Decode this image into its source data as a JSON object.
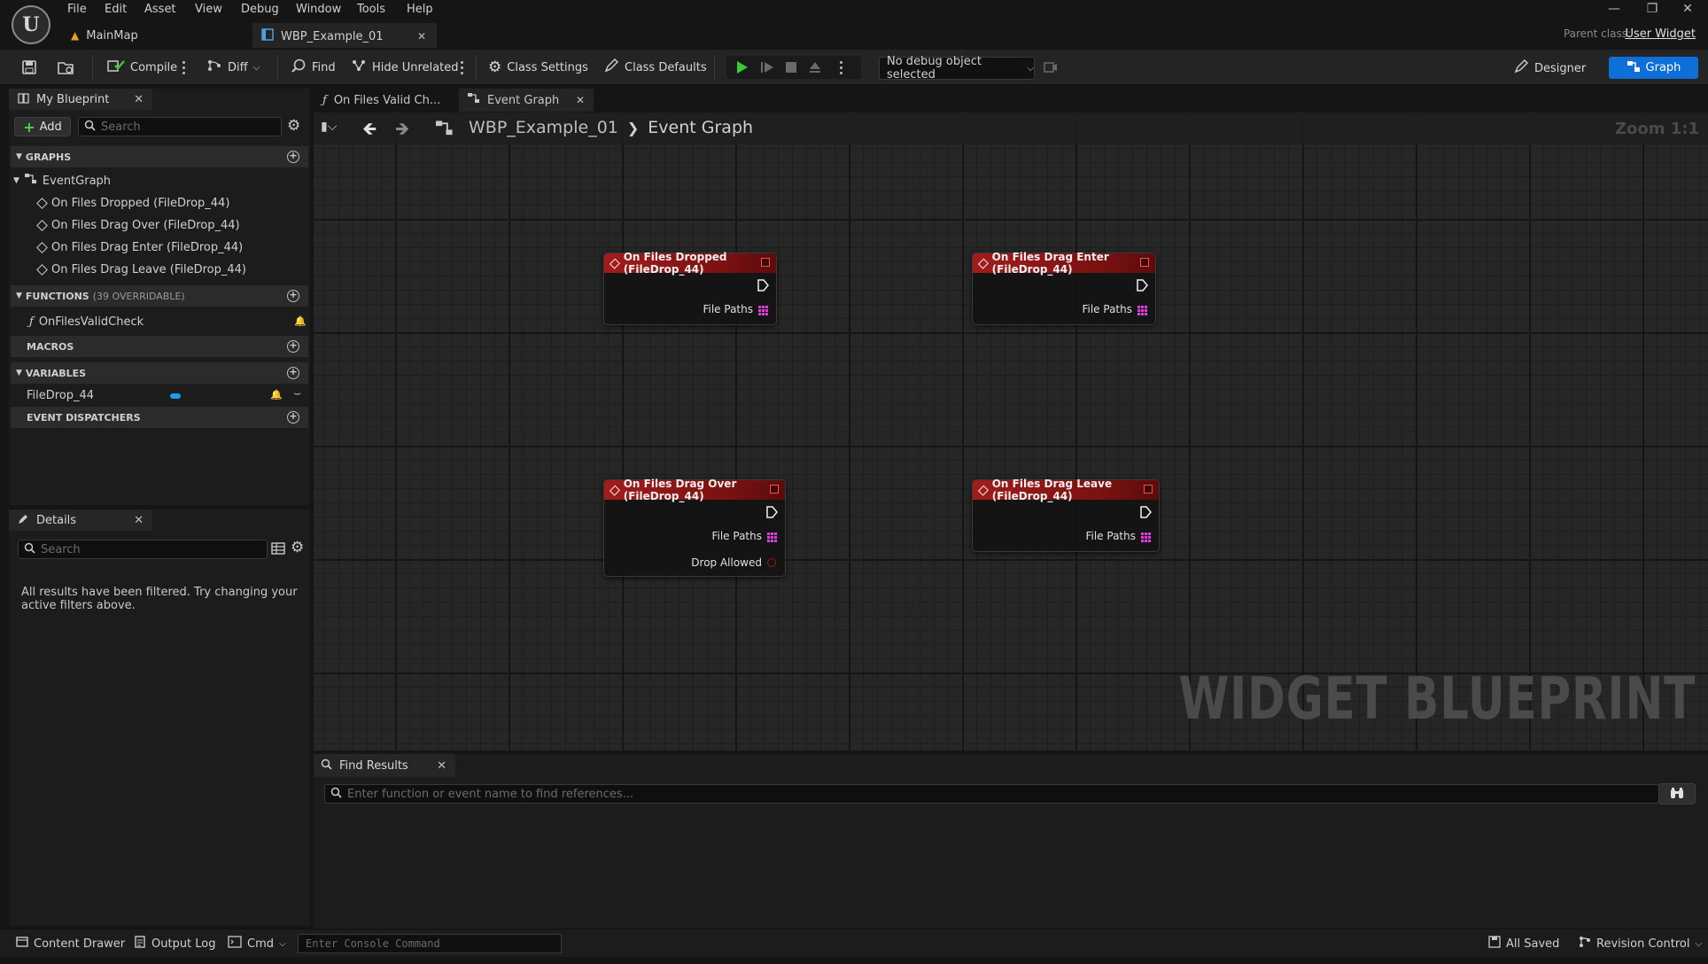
{
  "menu": [
    "File",
    "Edit",
    "Asset",
    "View",
    "Debug",
    "Window",
    "Tools",
    "Help"
  ],
  "logo_letter": "U",
  "doc_tabs": [
    {
      "label": "MainMap"
    },
    {
      "label": "WBP_Example_01"
    }
  ],
  "parent_class": {
    "label": "Parent class:",
    "value": "User Widget"
  },
  "toolbar": {
    "compile": "Compile",
    "diff": "Diff",
    "find": "Find",
    "hide_unrelated": "Hide Unrelated",
    "class_settings": "Class Settings",
    "class_defaults": "Class Defaults",
    "debug_object": "No debug object selected",
    "designer": "Designer",
    "graph": "Graph"
  },
  "my_blueprint": {
    "tab_label": "My Blueprint",
    "add_label": "Add",
    "search_placeholder": "Search",
    "sections": {
      "graphs": "GRAPHS",
      "functions": "FUNCTIONS",
      "functions_sub": "(39 OVERRIDABLE)",
      "macros": "MACROS",
      "variables": "VARIABLES",
      "event_dispatchers": "EVENT DISPATCHERS"
    },
    "event_graph": "EventGraph",
    "events": [
      "On Files Dropped (FileDrop_44)",
      "On Files Drag Over (FileDrop_44)",
      "On Files Drag Enter (FileDrop_44)",
      "On Files Drag Leave (FileDrop_44)"
    ],
    "functions": [
      "OnFilesValidCheck"
    ],
    "variables": [
      "FileDrop_44"
    ]
  },
  "details": {
    "tab_label": "Details",
    "search_placeholder": "Search",
    "empty_message": "All results have been filtered. Try changing your active filters above."
  },
  "graph_tabs": [
    {
      "label": "On Files Valid Ch..."
    },
    {
      "label": "Event Graph"
    }
  ],
  "breadcrumb": {
    "root": "WBP_Example_01",
    "current": "Event Graph"
  },
  "zoom": "Zoom 1:1",
  "watermark": "WIDGET BLUEPRINT",
  "nodes": [
    {
      "title": "On Files Dropped (FileDrop_44)",
      "pins": [
        "File Paths"
      ]
    },
    {
      "title": "On Files Drag Enter (FileDrop_44)",
      "pins": [
        "File Paths"
      ]
    },
    {
      "title": "On Files Drag Over (FileDrop_44)",
      "pins": [
        "File Paths",
        "Drop Allowed"
      ]
    },
    {
      "title": "On Files Drag Leave (FileDrop_44)",
      "pins": [
        "File Paths"
      ]
    }
  ],
  "find_results": {
    "tab_label": "Find Results",
    "placeholder": "Enter function or event name to find references..."
  },
  "statusbar": {
    "content_drawer": "Content Drawer",
    "output_log": "Output Log",
    "cmd": "Cmd",
    "console_placeholder": "Enter Console Command",
    "all_saved": "All Saved",
    "revision_control": "Revision Control"
  },
  "colors": {
    "accent": "#0e6fda",
    "event_header": "#a31c1c",
    "array_pin": "#e23be3",
    "variable_type": "#1a9cf0"
  }
}
